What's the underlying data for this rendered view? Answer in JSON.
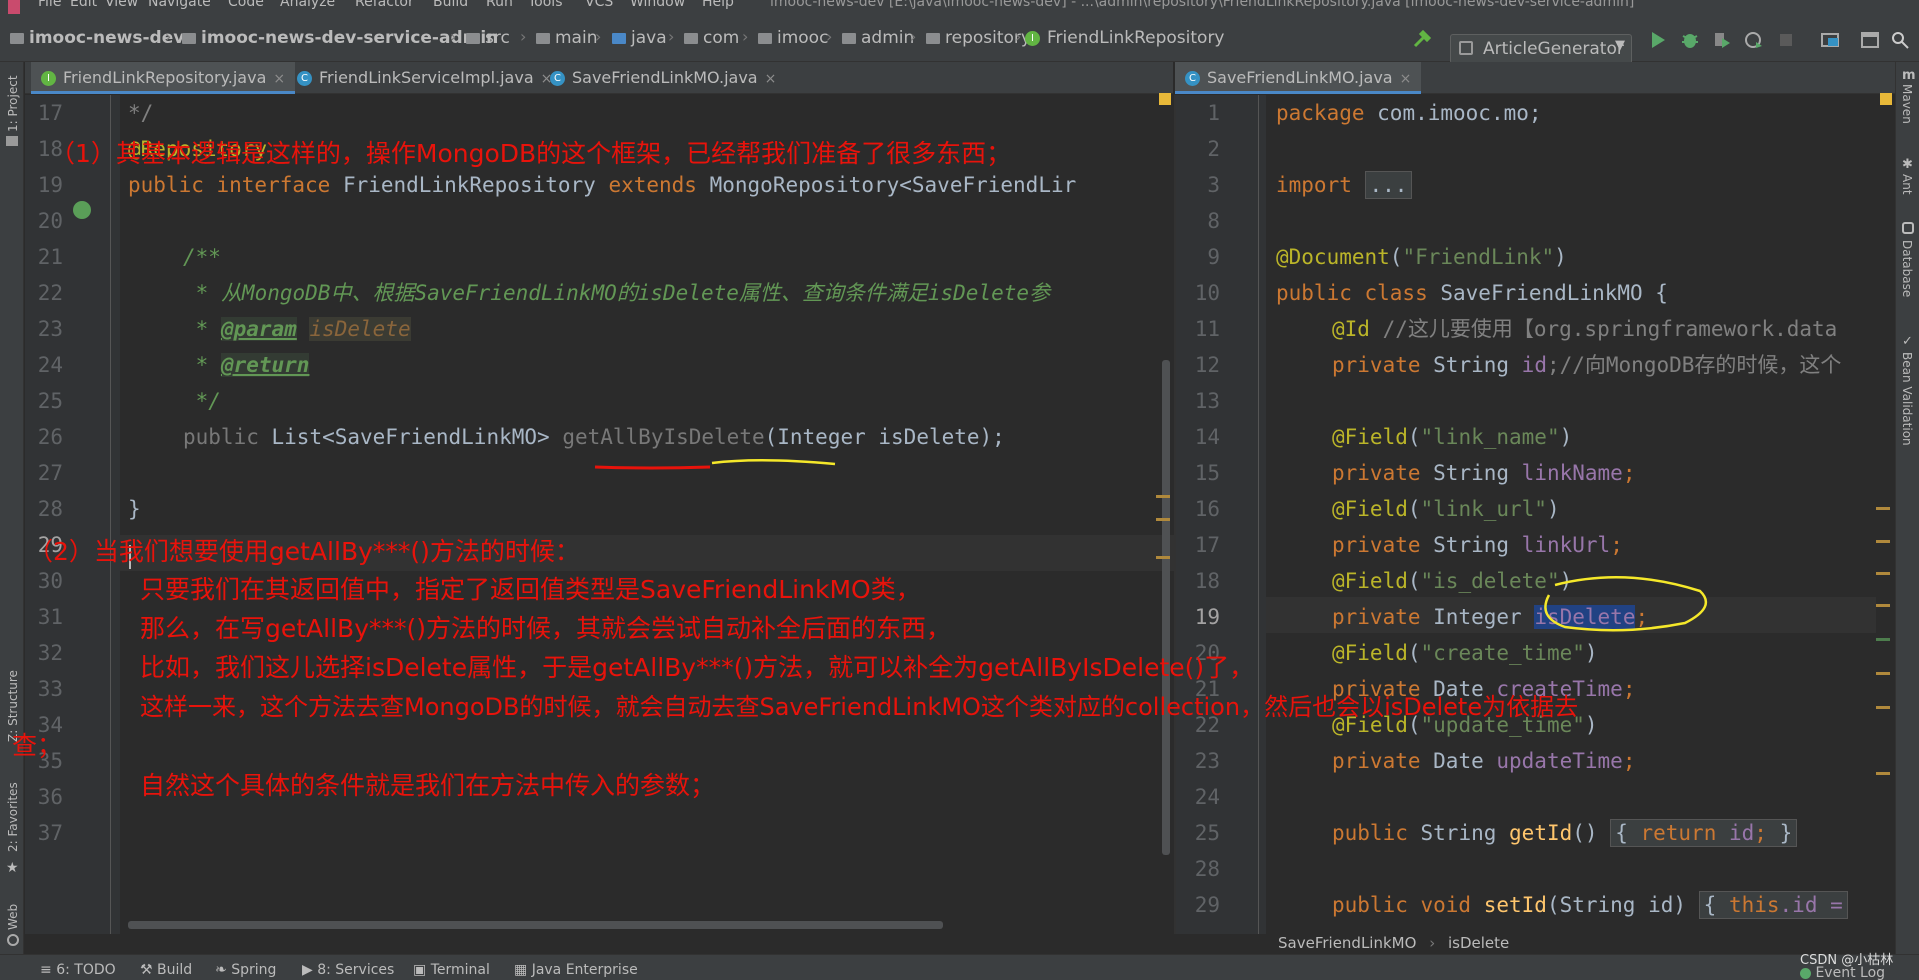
{
  "menu": [
    "File",
    "Edit",
    "View",
    "Navigate",
    "Code",
    "Analyze",
    "Refactor",
    "Build",
    "Run",
    "Tools",
    "VCS",
    "Window",
    "Help"
  ],
  "window_title": "imooc-news-dev [E:\\java\\imooc-news-dev] - ...\\admin\\repository\\FriendLinkRepository.java [imooc-news-dev-service-admin]",
  "breadcrumbs": [
    "imooc-news-dev",
    "imooc-news-dev-service-admin",
    "src",
    "main",
    "java",
    "com",
    "imooc",
    "admin",
    "repository",
    "FriendLinkRepository"
  ],
  "run_config": "ArticleGenerator",
  "left_tabs": [
    {
      "label": "FriendLinkRepository.java",
      "icon": "I"
    },
    {
      "label": "FriendLinkServiceImpl.java",
      "icon": "C"
    },
    {
      "label": "SaveFriendLinkMO.java",
      "icon": "C"
    }
  ],
  "right_tabs": [
    {
      "label": "SaveFriendLinkMO.java",
      "icon": "C"
    }
  ],
  "left_tool_windows": [
    "1: Project",
    "Z: Structure",
    "2: Favorites",
    "Web"
  ],
  "right_tool_windows": [
    "Maven",
    "Ant",
    "Database",
    "Bean Validation"
  ],
  "left_line_numbers": [
    "17",
    "18",
    "19",
    "20",
    "21",
    "22",
    "23",
    "24",
    "25",
    "26",
    "27",
    "28",
    "29",
    "30",
    "31",
    "32",
    "33",
    "34",
    "35",
    "36",
    "37"
  ],
  "left_code": {
    "l17": "*/",
    "l18": "@Repository",
    "l19_kw1": "public interface ",
    "l19_name": "FriendLinkRepository ",
    "l19_kw2": "extends ",
    "l19_rest": "MongoRepository<SaveFriendLir",
    "l21": "/**",
    "l22_star": " * ",
    "l22_text": "从MongoDB中、根据SaveFriendLinkMO的isDelete属性、查询条件满足isDelete参",
    "l23_star": " * ",
    "l23_tag": "@param",
    "l23_p": "isDelete",
    "l24_star": " * ",
    "l24_tag": "@return",
    "l25": " */",
    "l26_a": "public ",
    "l26_b": "List<SaveFriendLinkMO> ",
    "l26_m": "getAllByIsDelete",
    "l26_c": "(Integer isDelete);",
    "l28": "}"
  },
  "right_line_numbers": [
    "1",
    "2",
    "3",
    "8",
    "9",
    "10",
    "11",
    "12",
    "13",
    "14",
    "15",
    "16",
    "17",
    "18",
    "19",
    "20",
    "21",
    "22",
    "23",
    "24",
    "25",
    "28",
    "29"
  ],
  "right_code": {
    "r1_kw": "package ",
    "r1_rest": "com.imooc.mo;",
    "r3_kw": "import ",
    "r3_fold": "...",
    "r9_ann": "@Document",
    "r9_a": "(",
    "r9_str": "\"FriendLink\"",
    "r9_b": ")",
    "r10_kw": "public class ",
    "r10_rest": "SaveFriendLinkMO {",
    "r11_ann": "@Id ",
    "r11_cmt": "//这儿要使用【org.springframework.data",
    "r12_kw": "private ",
    "r12_t": "String ",
    "r12_f": "id",
    "r12_cmt": ";//向MongoDB存的时候，这个",
    "r14_ann": "@Field",
    "r14_str": "\"link_name\"",
    "r15_f": "linkName",
    "r16_str": "\"link_url\"",
    "r17_f": "linkUrl",
    "r18_str": "\"is_delete\"",
    "r19_t": "Integer ",
    "r19_f": "isDelete",
    "r20_str": "\"create_time\"",
    "r21_t": "Date ",
    "r21_f": "createTime",
    "r22_str": "\"update_time\"",
    "r23_f": "updateTime",
    "r25_m": "getId",
    "r25_body": "return ",
    "r25_f": "id",
    "r29_m": "setId",
    "r29_args": "(String id) ",
    "r29_body": "this",
    "r29_f": ".id ="
  },
  "annotations": {
    "a1": "（1）其基本逻辑是这样的，操作MongoDB的这个框架，已经帮我们准备了很多东西；",
    "a2": "（2）当我们想要使用getAllBy***()方法的时候：",
    "a3": "只要我们在其返回值中，指定了返回值类型是SaveFriendLinkMO类，",
    "a4": "那么，在写getAllBy***()方法的时候，其就会尝试自动补全后面的东西，",
    "a5": "比如，我们这儿选择isDelete属性，于是getAllBy***()方法，就可以补全为getAllByIsDelete()了，",
    "a6": "这样一来，这个方法去查MongoDB的时候，就会自动去查SaveFriendLinkMO这个类对应的collection，然后也会以isDelete为依据去",
    "a7": "查；",
    "a8": "自然这个具体的条件就是我们在方法中传入的参数；"
  },
  "status_path": [
    "SaveFriendLinkMO",
    "isDelete"
  ],
  "bottom_tools": [
    "6: TODO",
    "Build",
    "Spring",
    "8: Services",
    "Terminal",
    "Java Enterprise"
  ],
  "event_log": "Event Log",
  "watermark": "CSDN @小枯林",
  "colors": {
    "annotation_red": "#e8130b",
    "underline_red": "#e8130b",
    "underline_yellow": "#f5e82a",
    "accent_blue": "#4a88c7"
  }
}
